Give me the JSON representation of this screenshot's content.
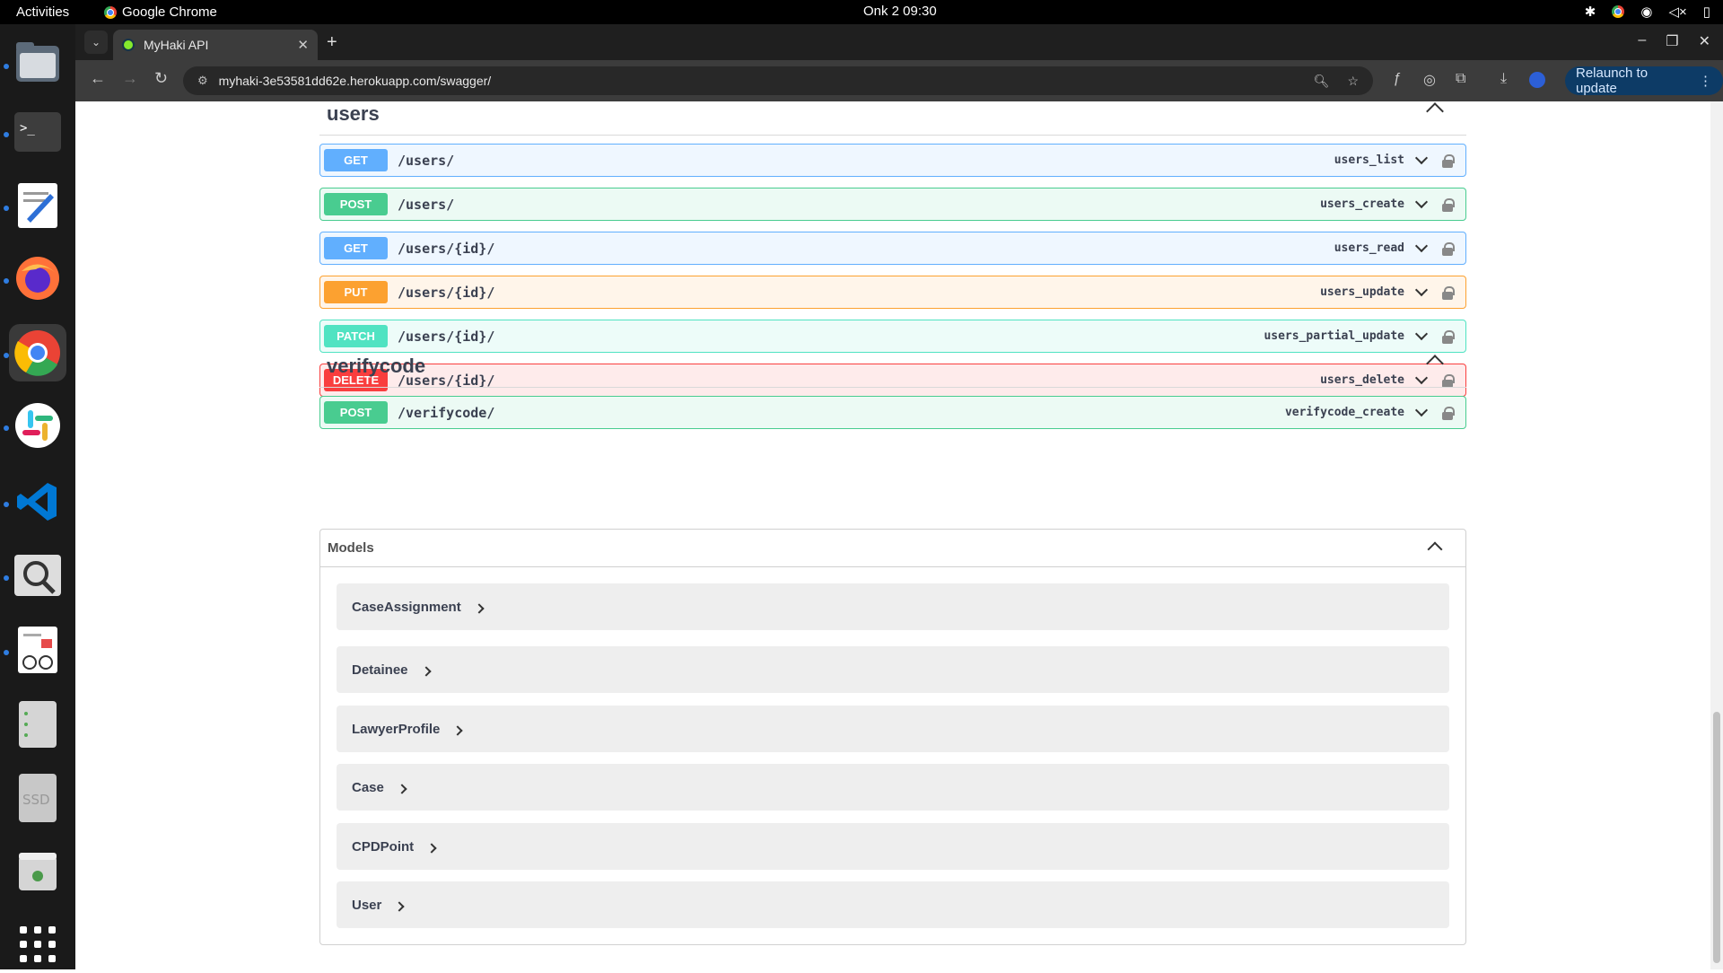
{
  "system": {
    "activities": "Activities",
    "app_name": "Google Chrome",
    "clock": "Onk 2  09:30"
  },
  "dock": {
    "items": [
      "files-icon",
      "terminal-icon",
      "text-editor-icon",
      "firefox-icon",
      "chrome-icon",
      "slack-icon",
      "vscode-icon",
      "image-viewer-icon",
      "document-viewer-icon",
      "server-icon",
      "ssd-icon",
      "trash-icon",
      "app-grid-icon"
    ],
    "ssd_label": "SSD"
  },
  "browser": {
    "tab_title": "MyHaki API",
    "url": "myhaki-3e53581dd62e.herokuapp.com/swagger/",
    "relaunch_label": "Relaunch to update",
    "accent_color": "#0d3b66"
  },
  "sections": [
    {
      "title": "users",
      "operations": [
        {
          "method": "GET",
          "path": "/users/",
          "operation_id": "users_list"
        },
        {
          "method": "POST",
          "path": "/users/",
          "operation_id": "users_create"
        },
        {
          "method": "GET",
          "path": "/users/{id}/",
          "operation_id": "users_read"
        },
        {
          "method": "PUT",
          "path": "/users/{id}/",
          "operation_id": "users_update"
        },
        {
          "method": "PATCH",
          "path": "/users/{id}/",
          "operation_id": "users_partial_update"
        },
        {
          "method": "DELETE",
          "path": "/users/{id}/",
          "operation_id": "users_delete"
        }
      ]
    },
    {
      "title": "verifycode",
      "operations": [
        {
          "method": "POST",
          "path": "/verifycode/",
          "operation_id": "verifycode_create"
        }
      ]
    }
  ],
  "models": {
    "title": "Models",
    "items": [
      "CaseAssignment",
      "Detainee",
      "LawyerProfile",
      "Case",
      "CPDPoint",
      "User"
    ]
  },
  "method_colors": {
    "GET": "#61affe",
    "POST": "#49cc90",
    "PUT": "#fca130",
    "PATCH": "#50e3c2",
    "DELETE": "#f93e3e"
  }
}
